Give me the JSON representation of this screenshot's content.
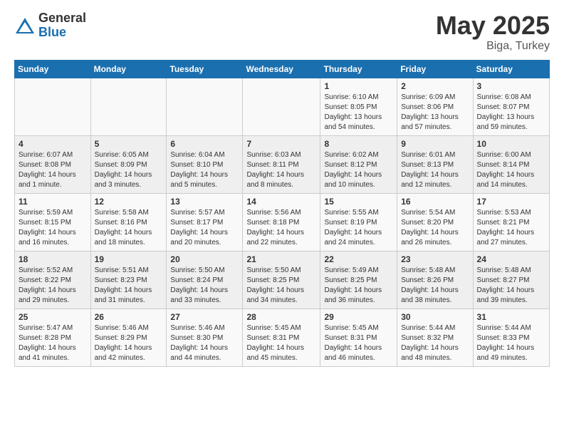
{
  "header": {
    "logo_general": "General",
    "logo_blue": "Blue",
    "title": "May 2025",
    "location": "Biga, Turkey"
  },
  "weekdays": [
    "Sunday",
    "Monday",
    "Tuesday",
    "Wednesday",
    "Thursday",
    "Friday",
    "Saturday"
  ],
  "weeks": [
    [
      {
        "day": "",
        "info": ""
      },
      {
        "day": "",
        "info": ""
      },
      {
        "day": "",
        "info": ""
      },
      {
        "day": "",
        "info": ""
      },
      {
        "day": "1",
        "info": "Sunrise: 6:10 AM\nSunset: 8:05 PM\nDaylight: 13 hours and 54 minutes."
      },
      {
        "day": "2",
        "info": "Sunrise: 6:09 AM\nSunset: 8:06 PM\nDaylight: 13 hours and 57 minutes."
      },
      {
        "day": "3",
        "info": "Sunrise: 6:08 AM\nSunset: 8:07 PM\nDaylight: 13 hours and 59 minutes."
      }
    ],
    [
      {
        "day": "4",
        "info": "Sunrise: 6:07 AM\nSunset: 8:08 PM\nDaylight: 14 hours and 1 minute."
      },
      {
        "day": "5",
        "info": "Sunrise: 6:05 AM\nSunset: 8:09 PM\nDaylight: 14 hours and 3 minutes."
      },
      {
        "day": "6",
        "info": "Sunrise: 6:04 AM\nSunset: 8:10 PM\nDaylight: 14 hours and 5 minutes."
      },
      {
        "day": "7",
        "info": "Sunrise: 6:03 AM\nSunset: 8:11 PM\nDaylight: 14 hours and 8 minutes."
      },
      {
        "day": "8",
        "info": "Sunrise: 6:02 AM\nSunset: 8:12 PM\nDaylight: 14 hours and 10 minutes."
      },
      {
        "day": "9",
        "info": "Sunrise: 6:01 AM\nSunset: 8:13 PM\nDaylight: 14 hours and 12 minutes."
      },
      {
        "day": "10",
        "info": "Sunrise: 6:00 AM\nSunset: 8:14 PM\nDaylight: 14 hours and 14 minutes."
      }
    ],
    [
      {
        "day": "11",
        "info": "Sunrise: 5:59 AM\nSunset: 8:15 PM\nDaylight: 14 hours and 16 minutes."
      },
      {
        "day": "12",
        "info": "Sunrise: 5:58 AM\nSunset: 8:16 PM\nDaylight: 14 hours and 18 minutes."
      },
      {
        "day": "13",
        "info": "Sunrise: 5:57 AM\nSunset: 8:17 PM\nDaylight: 14 hours and 20 minutes."
      },
      {
        "day": "14",
        "info": "Sunrise: 5:56 AM\nSunset: 8:18 PM\nDaylight: 14 hours and 22 minutes."
      },
      {
        "day": "15",
        "info": "Sunrise: 5:55 AM\nSunset: 8:19 PM\nDaylight: 14 hours and 24 minutes."
      },
      {
        "day": "16",
        "info": "Sunrise: 5:54 AM\nSunset: 8:20 PM\nDaylight: 14 hours and 26 minutes."
      },
      {
        "day": "17",
        "info": "Sunrise: 5:53 AM\nSunset: 8:21 PM\nDaylight: 14 hours and 27 minutes."
      }
    ],
    [
      {
        "day": "18",
        "info": "Sunrise: 5:52 AM\nSunset: 8:22 PM\nDaylight: 14 hours and 29 minutes."
      },
      {
        "day": "19",
        "info": "Sunrise: 5:51 AM\nSunset: 8:23 PM\nDaylight: 14 hours and 31 minutes."
      },
      {
        "day": "20",
        "info": "Sunrise: 5:50 AM\nSunset: 8:24 PM\nDaylight: 14 hours and 33 minutes."
      },
      {
        "day": "21",
        "info": "Sunrise: 5:50 AM\nSunset: 8:25 PM\nDaylight: 14 hours and 34 minutes."
      },
      {
        "day": "22",
        "info": "Sunrise: 5:49 AM\nSunset: 8:25 PM\nDaylight: 14 hours and 36 minutes."
      },
      {
        "day": "23",
        "info": "Sunrise: 5:48 AM\nSunset: 8:26 PM\nDaylight: 14 hours and 38 minutes."
      },
      {
        "day": "24",
        "info": "Sunrise: 5:48 AM\nSunset: 8:27 PM\nDaylight: 14 hours and 39 minutes."
      }
    ],
    [
      {
        "day": "25",
        "info": "Sunrise: 5:47 AM\nSunset: 8:28 PM\nDaylight: 14 hours and 41 minutes."
      },
      {
        "day": "26",
        "info": "Sunrise: 5:46 AM\nSunset: 8:29 PM\nDaylight: 14 hours and 42 minutes."
      },
      {
        "day": "27",
        "info": "Sunrise: 5:46 AM\nSunset: 8:30 PM\nDaylight: 14 hours and 44 minutes."
      },
      {
        "day": "28",
        "info": "Sunrise: 5:45 AM\nSunset: 8:31 PM\nDaylight: 14 hours and 45 minutes."
      },
      {
        "day": "29",
        "info": "Sunrise: 5:45 AM\nSunset: 8:31 PM\nDaylight: 14 hours and 46 minutes."
      },
      {
        "day": "30",
        "info": "Sunrise: 5:44 AM\nSunset: 8:32 PM\nDaylight: 14 hours and 48 minutes."
      },
      {
        "day": "31",
        "info": "Sunrise: 5:44 AM\nSunset: 8:33 PM\nDaylight: 14 hours and 49 minutes."
      }
    ]
  ]
}
